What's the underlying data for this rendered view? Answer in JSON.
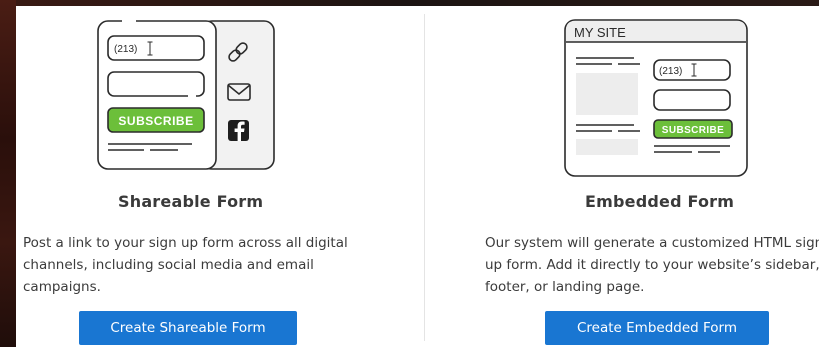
{
  "shareable": {
    "illustration": {
      "phone_value": "(213)",
      "subscribe_label": "SUBSCRIBE",
      "share_icons": [
        "link-icon",
        "mail-icon",
        "facebook-icon"
      ]
    },
    "title": "Shareable Form",
    "description": "Post a link to your sign up form across all digital channels, including social media and email campaigns.",
    "cta_label": "Create Shareable Form"
  },
  "embedded": {
    "illustration": {
      "site_label": "MY SITE",
      "phone_value": "(213)",
      "subscribe_label": "SUBSCRIBE"
    },
    "title": "Embedded Form",
    "description": "Our system will generate a customized HTML sign up form. Add it directly to your website’s sidebar, footer, or landing page.",
    "cta_label": "Create Embedded Form"
  },
  "colors": {
    "primary_button": "#1976d2",
    "subscribe_green": "#6cbf3a",
    "outline": "#2b2b2b"
  }
}
